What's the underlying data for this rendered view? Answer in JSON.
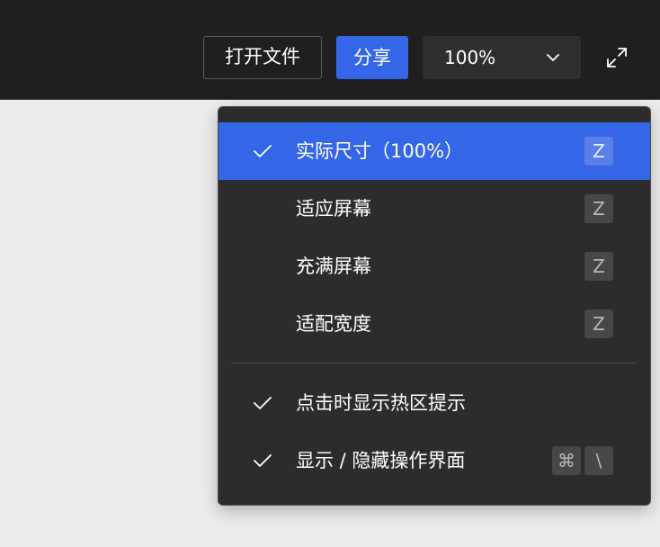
{
  "toolbar": {
    "open_file_label": "打开文件",
    "share_label": "分享",
    "zoom_value": "100%",
    "zoom_dropdown_icon": "chevron-down-icon",
    "fullscreen_icon": "expand-icon"
  },
  "zoom_menu": {
    "items": [
      {
        "label": "实际尺寸（100%）",
        "shortcut": [
          "Z"
        ],
        "checked": true,
        "selected": true
      },
      {
        "label": "适应屏幕",
        "shortcut": [
          "Z"
        ],
        "checked": false,
        "selected": false
      },
      {
        "label": "充满屏幕",
        "shortcut": [
          "Z"
        ],
        "checked": false,
        "selected": false
      },
      {
        "label": "适配宽度",
        "shortcut": [
          "Z"
        ],
        "checked": false,
        "selected": false
      }
    ],
    "options": [
      {
        "label": "点击时显示热区提示",
        "shortcut": [],
        "checked": true
      },
      {
        "label": "显示 / 隐藏操作界面",
        "shortcut": [
          "⌘",
          "\\"
        ],
        "checked": true
      }
    ]
  },
  "colors": {
    "toolbar_bg": "#1f1f1f",
    "accent": "#3566e8",
    "menu_bg": "#2c2c2c",
    "canvas_bg": "#ececec"
  }
}
